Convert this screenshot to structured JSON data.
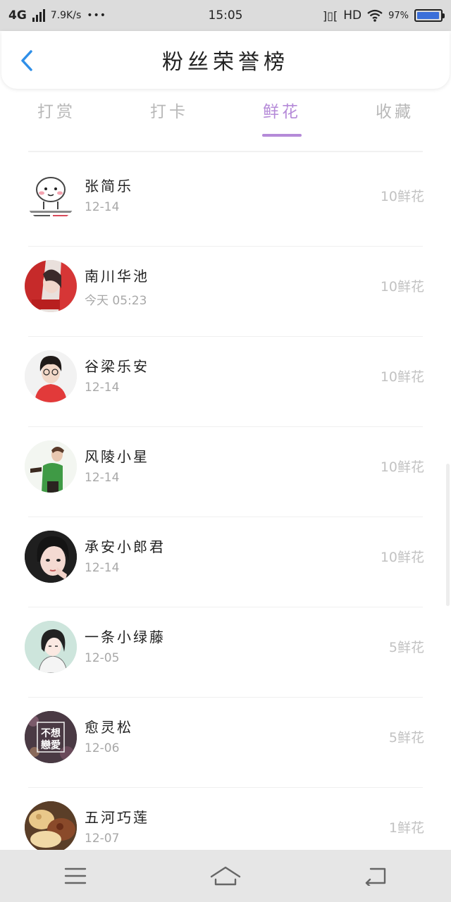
{
  "status_bar": {
    "network": "4G",
    "speed": "7.9K/s",
    "dots": "•••",
    "time": "15:05",
    "vibrate_symbol": "]▯[",
    "hd": "HD",
    "battery": "97%",
    "battery_level": 0.97,
    "battery_color": "#3b6fd9"
  },
  "header": {
    "title": "粉丝荣誉榜",
    "back_icon": "chevron-left-icon",
    "back_color": "#2f8fe8"
  },
  "tabs": [
    {
      "label": "打赏",
      "active": false
    },
    {
      "label": "打卡",
      "active": false
    },
    {
      "label": "鲜花",
      "active": true
    },
    {
      "label": "收藏",
      "active": false
    }
  ],
  "accent_color": "#b58ad8",
  "list": [
    {
      "name": "张简乐",
      "date": "12-14",
      "count": "10鲜花",
      "avatar": "cartoon-face-avatar"
    },
    {
      "name": "南川华池",
      "date": "今天 05:23",
      "count": "10鲜花",
      "avatar": "red-photo-avatar"
    },
    {
      "name": "谷梁乐安",
      "date": "12-14",
      "count": "10鲜花",
      "avatar": "boy-red-shirt-avatar"
    },
    {
      "name": "风陵小星",
      "date": "12-14",
      "count": "10鲜花",
      "avatar": "green-shirt-avatar"
    },
    {
      "name": "承安小郎君",
      "date": "12-14",
      "count": "10鲜花",
      "avatar": "girl-dark-hair-avatar"
    },
    {
      "name": "一条小绿藤",
      "date": "12-05",
      "count": "5鲜花",
      "avatar": "anime-girl-avatar"
    },
    {
      "name": "愈灵松",
      "date": "12-06",
      "count": "5鲜花",
      "avatar": "text-image-avatar",
      "avatar_text": "不想 戀愛"
    },
    {
      "name": "五河巧莲",
      "date": "12-07",
      "count": "1鲜花",
      "avatar": "food-photo-avatar"
    }
  ],
  "nav": {
    "menu_icon": "menu-icon",
    "home_icon": "home-icon",
    "back_icon": "back-arrow-icon"
  }
}
